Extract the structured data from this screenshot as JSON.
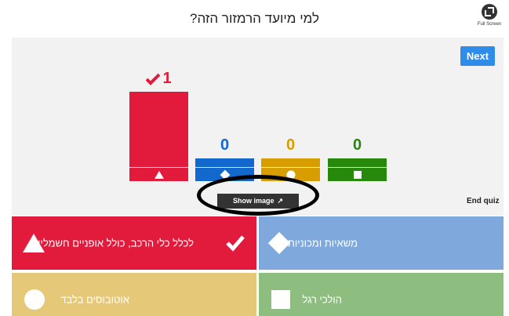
{
  "header": {
    "question": "למי מיועד הרמזור הזה?",
    "fullscreen_label": "Full Screen"
  },
  "stage": {
    "next_label": "Next",
    "end_quiz_label": "End quiz",
    "show_image_label": "Show image",
    "show_image_icon": "external-link-icon"
  },
  "results": [
    {
      "count": "1",
      "correct": true,
      "color": "#e21b3c",
      "shape": "triangle"
    },
    {
      "count": "0",
      "correct": false,
      "color": "#1368ce",
      "shape": "diamond"
    },
    {
      "count": "0",
      "correct": false,
      "color": "#d89e00",
      "shape": "circle"
    },
    {
      "count": "0",
      "correct": false,
      "color": "#26890c",
      "shape": "square"
    }
  ],
  "answers": [
    {
      "text": "לכלל כלי הרכב, כולל אופניים חשמליים",
      "shape": "triangle",
      "correct": true,
      "color": "#e21b3c"
    },
    {
      "text": "משאיות ומכוניות",
      "shape": "diamond",
      "correct": false,
      "color": "#7fa9dc"
    },
    {
      "text": "אוטובוסים בלבד",
      "shape": "circle",
      "correct": false,
      "color": "#e6c879"
    },
    {
      "text": "הולכי רגל",
      "shape": "square",
      "correct": false,
      "color": "#8ebe7f"
    }
  ]
}
